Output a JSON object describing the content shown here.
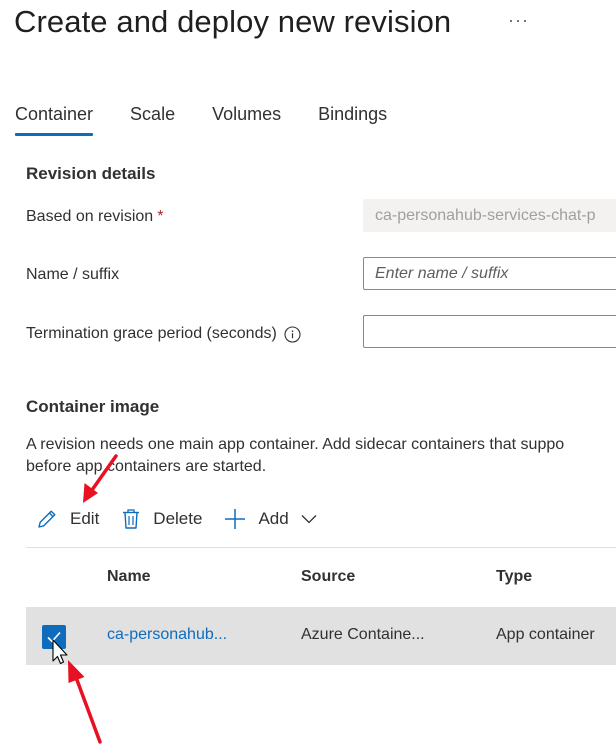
{
  "page": {
    "title": "Create and deploy new revision",
    "more_label": "···"
  },
  "tabs": [
    {
      "label": "Container",
      "active": true
    },
    {
      "label": "Scale",
      "active": false
    },
    {
      "label": "Volumes",
      "active": false
    },
    {
      "label": "Bindings",
      "active": false
    }
  ],
  "revision_details": {
    "heading": "Revision details",
    "based_on": {
      "label": "Based on revision",
      "required_mark": "*",
      "value": "ca-personahub-services-chat-p"
    },
    "name_suffix": {
      "label": "Name / suffix",
      "placeholder": "Enter name / suffix"
    },
    "termination": {
      "label": "Termination grace period (seconds)",
      "value": ""
    }
  },
  "container_image": {
    "heading": "Container image",
    "description_line1": "A revision needs one main app container. Add sidecar containers that suppo",
    "description_line2": "before app containers are started."
  },
  "toolbar": {
    "edit_label": "Edit",
    "delete_label": "Delete",
    "add_label": "Add"
  },
  "table": {
    "columns": [
      "Name",
      "Source",
      "Type"
    ],
    "rows": [
      {
        "name": "ca-personahub...",
        "source": "Azure Containe...",
        "type": "App container",
        "selected": true
      }
    ]
  },
  "colors": {
    "accent": "#0f6cbd",
    "annotation_arrow": "#e81123",
    "row_selected_bg": "#e1e1e1"
  }
}
